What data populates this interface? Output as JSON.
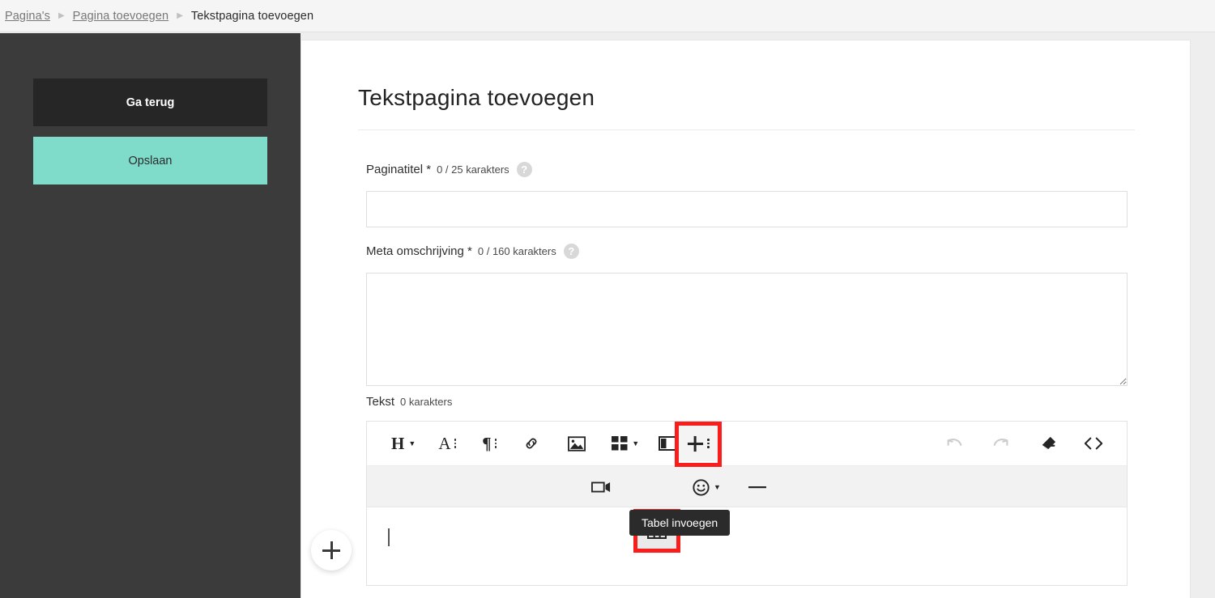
{
  "breadcrumb": {
    "items": [
      {
        "label": "Pagina's",
        "current": false
      },
      {
        "label": "Pagina toevoegen",
        "current": false
      },
      {
        "label": "Tekstpagina toevoegen",
        "current": true
      }
    ],
    "separator": "▶"
  },
  "sidebar": {
    "back_label": "Ga terug",
    "save_label": "Opslaan",
    "background_color": "#3b3b3b",
    "back_color": "#262626",
    "save_color": "#7fdccb"
  },
  "main": {
    "page_title": "Tekstpagina toevoegen",
    "fields": {
      "title": {
        "label": "Paginatitel *",
        "counter": "0 / 25 karakters",
        "help": "?",
        "value": "",
        "placeholder": ""
      },
      "meta": {
        "label": "Meta omschrijving *",
        "counter": "0 / 160 karakters",
        "help": "?",
        "value": "",
        "placeholder": ""
      },
      "text": {
        "label": "Tekst",
        "counter": "0 karakters",
        "value": ""
      }
    }
  },
  "editor": {
    "toolbar_row1": [
      {
        "name": "heading-icon",
        "glyph": "H",
        "caret": true
      },
      {
        "name": "font-style-icon",
        "glyph": "A",
        "dots": true
      },
      {
        "name": "paragraph-format-icon",
        "glyph": "¶",
        "dots": true
      },
      {
        "name": "insert-link-icon",
        "glyph": "link",
        "caret": false
      },
      {
        "name": "insert-image-icon",
        "glyph": "image",
        "caret": false
      },
      {
        "name": "insert-grid-icon",
        "glyph": "grid",
        "caret": true
      },
      {
        "name": "insert-columns-icon",
        "glyph": "columns",
        "caret": true
      }
    ],
    "more_tools": {
      "name": "more-tools-icon",
      "glyph": "+",
      "dots": true,
      "highlighted": true
    },
    "toolbar_row1_right": [
      {
        "name": "undo-icon",
        "glyph": "undo",
        "disabled": true
      },
      {
        "name": "redo-icon",
        "glyph": "redo",
        "disabled": true
      },
      {
        "name": "clear-formatting-icon",
        "glyph": "eraser",
        "disabled": false
      },
      {
        "name": "code-view-icon",
        "glyph": "code",
        "disabled": false
      }
    ],
    "toolbar_row2": [
      {
        "name": "insert-video-icon",
        "glyph": "video",
        "caret": false
      },
      {
        "name": "insert-table-icon",
        "glyph": "table",
        "caret": false,
        "highlighted": true
      },
      {
        "name": "insert-emoticon-icon",
        "glyph": "emoji",
        "caret": true
      },
      {
        "name": "insert-horizontal-line-icon",
        "glyph": "hr",
        "caret": false
      }
    ],
    "tooltip": "Tabel invoegen",
    "highlight_color": "#fb1c1c"
  },
  "floating": {
    "add_label": "+"
  }
}
